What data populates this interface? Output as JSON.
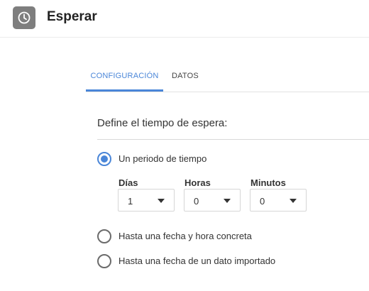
{
  "header": {
    "title": "Esperar",
    "icon": "clock-icon"
  },
  "tabs": [
    {
      "label": "CONFIGURACIÓN",
      "active": true
    },
    {
      "label": "DATOS",
      "active": false
    }
  ],
  "colors": {
    "accent": "#4a86d8",
    "header_icon_bg": "#7e7e7e"
  },
  "config": {
    "section_title": "Define el tiempo de espera:",
    "options": [
      {
        "label": "Un periodo de tiempo",
        "selected": true
      },
      {
        "label": "Hasta una fecha y hora concreta",
        "selected": false
      },
      {
        "label": "Hasta una fecha de un dato importado",
        "selected": false
      }
    ],
    "period": {
      "days": {
        "label": "Días",
        "value": "1"
      },
      "hours": {
        "label": "Horas",
        "value": "0"
      },
      "minutes": {
        "label": "Minutos",
        "value": "0"
      }
    }
  }
}
